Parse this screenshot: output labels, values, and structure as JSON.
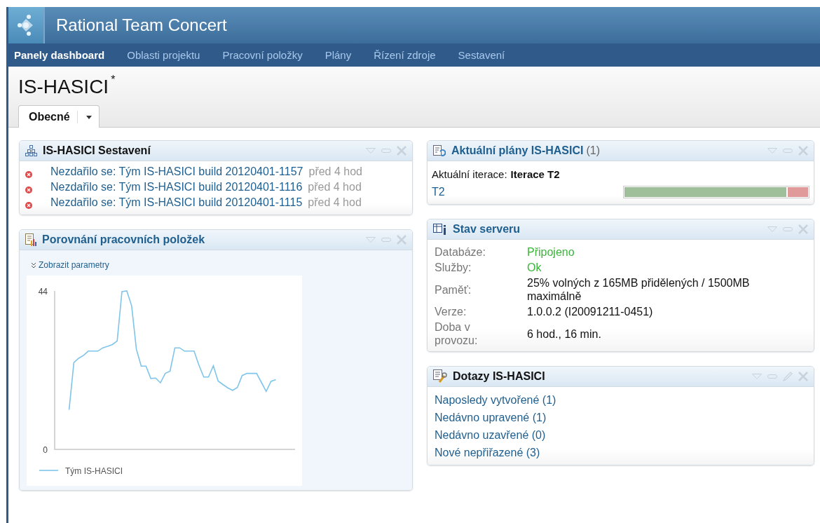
{
  "app": {
    "title": "Rational Team Concert"
  },
  "nav": [
    {
      "label": "Panely dashboard",
      "selected": true
    },
    {
      "label": "Oblasti projektu",
      "selected": false
    },
    {
      "label": "Pracovní položky",
      "selected": false
    },
    {
      "label": "Plány",
      "selected": false
    },
    {
      "label": "Řízení zdroje",
      "selected": false
    },
    {
      "label": "Sestavení",
      "selected": false
    }
  ],
  "page": {
    "title": "IS-HASICI",
    "title_mark": "*"
  },
  "tabs": [
    {
      "label": "Obecné",
      "selected": true
    }
  ],
  "builds_widget": {
    "title": "IS-HASICI Sestavení",
    "color": "#111111",
    "items": [
      {
        "text": "Nezdařilo se: Tým IS-HASICI build 20120401-1157",
        "time": "před 4 hod"
      },
      {
        "text": "Nezdařilo se: Tým IS-HASICI build 20120401-1116",
        "time": "před 4 hod"
      },
      {
        "text": "Nezdařilo se: Tým IS-HASICI build 20120401-1115",
        "time": "před 4 hod"
      }
    ]
  },
  "compare_widget": {
    "title": "Porovnání pracovních položek",
    "color": "#1f5f8f",
    "params_link": "Zobrazit parametry",
    "chart_data": {
      "type": "line",
      "ylim": [
        0,
        44
      ],
      "yticks": [
        0,
        44
      ],
      "categories": [
        null,
        null,
        null,
        null,
        null,
        null,
        null,
        null,
        null,
        null,
        null,
        null,
        null,
        null,
        null,
        null,
        null,
        null,
        null,
        null,
        null,
        null,
        null,
        null,
        null,
        null,
        null,
        null,
        null,
        null,
        null,
        null,
        null,
        null,
        null,
        null,
        null,
        null,
        null,
        null,
        null,
        null,
        null,
        null,
        null,
        null,
        null,
        null
      ],
      "series": [
        {
          "name": "Tým IS-HASICI",
          "color": "#7fc4ea",
          "values": [
            11.0,
            24.1,
            25.3,
            26.1,
            27.3,
            27.3,
            27.3,
            28.2,
            28.6,
            29.1,
            30.1,
            43.8,
            44,
            39.9,
            27.8,
            23.1,
            23.1,
            19.7,
            19.8,
            18.5,
            21.1,
            21.7,
            28.2,
            28.2,
            27.3,
            27.3,
            27.3,
            23.4,
            20.1,
            20.1,
            23.2,
            19.0,
            18,
            17.1,
            16.4,
            17.2,
            20.5,
            21.1,
            21.1,
            21.1,
            18.6,
            16.1,
            18.9,
            19.4,
            null,
            null,
            null,
            null
          ]
        }
      ]
    }
  },
  "plans_widget": {
    "title": "Aktuální plány IS-HASICI",
    "count": "(1)",
    "color": "#1f5f8f",
    "iteration_label": "Aktuální iterace:",
    "iteration_value": "Iterace T2",
    "plans": [
      {
        "name": "T2",
        "level": 0.88
      }
    ]
  },
  "server_widget": {
    "title": "Stav serveru",
    "color": "#1f5f8f",
    "rows": [
      {
        "label": "Databáze:",
        "value": "Připojeno",
        "color": "#3cb43c"
      },
      {
        "label": "Služby:",
        "value": "Ok",
        "color": "#3cb43c"
      },
      {
        "label": "Paměť:",
        "value": "25% volných z 165MB přidělených / 1500MB maximálně",
        "color": "#111111"
      },
      {
        "label": "Verze:",
        "value": "1.0.0.2 (I20091211-0451)",
        "color": "#111111"
      },
      {
        "label": "Doba v provozu:",
        "value": "6 hod., 16 min.",
        "color": "#111111"
      }
    ]
  },
  "queries_widget": {
    "title": "Dotazy IS-HASICI",
    "color": "#111111",
    "editable": true,
    "links": [
      "Naposledy vytvořené (1)",
      "Nedávno upravené (1)",
      "Nedávno uzavřené (0)",
      "Nové nepřiřazené (3)"
    ]
  }
}
